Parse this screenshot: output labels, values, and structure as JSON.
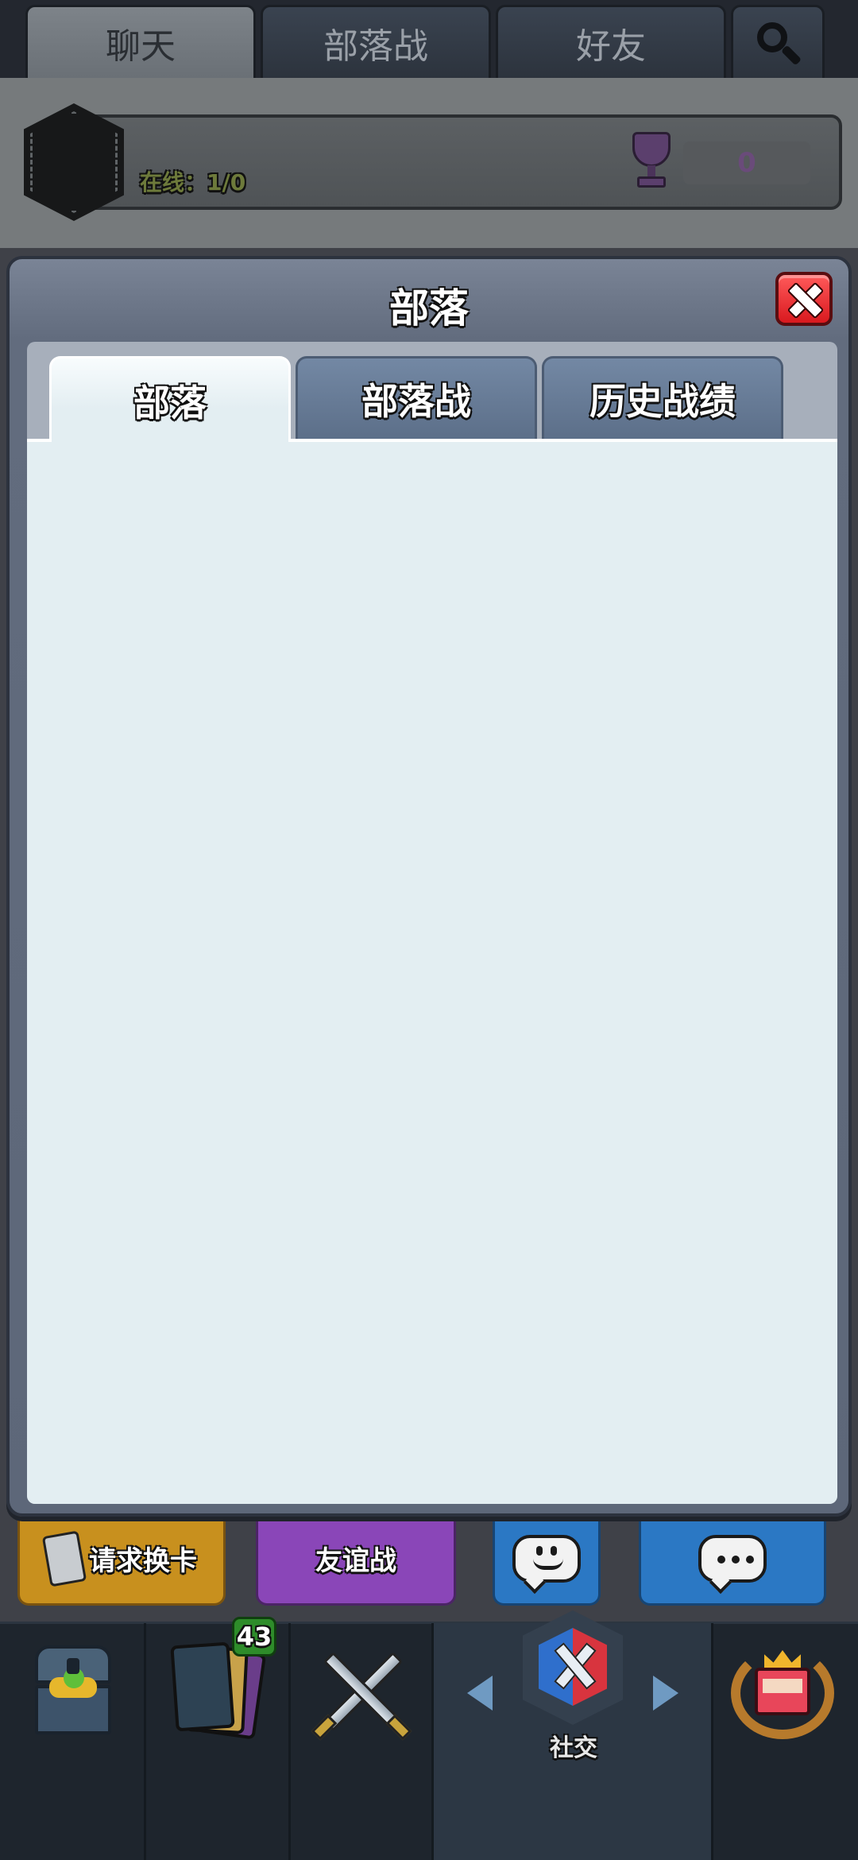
{
  "top_tabs": [
    {
      "label": "聊天"
    },
    {
      "label": "部落战"
    },
    {
      "label": "好友"
    }
  ],
  "clan_header": {
    "online_text": "在线：1/0",
    "trophies": "0"
  },
  "modal": {
    "title": "部落",
    "tabs": [
      {
        "label": "部落",
        "active": true
      },
      {
        "label": "部落战",
        "active": false
      },
      {
        "label": "历史战绩",
        "active": false
      }
    ]
  },
  "actions": {
    "request_cards": "请求换卡",
    "friendly_battle": "友谊战"
  },
  "bottom_nav": {
    "cards_badge": "43",
    "social_label": "社交"
  },
  "icons": [
    "search-icon",
    "trophy-icon",
    "close-icon",
    "card-icon",
    "emote-icon",
    "chat-icon",
    "chest-icon",
    "cards-icon",
    "battle-icon",
    "social-icon",
    "events-icon"
  ],
  "colors": {
    "close_red": "#d9191f",
    "panel": "#e3eef2",
    "tab_inactive": "#5c6f89",
    "request_yellow": "#c8901e",
    "friendly_purple": "#8a46b8",
    "chat_blue": "#2b78c4",
    "badge_green": "#2e8c2a"
  }
}
